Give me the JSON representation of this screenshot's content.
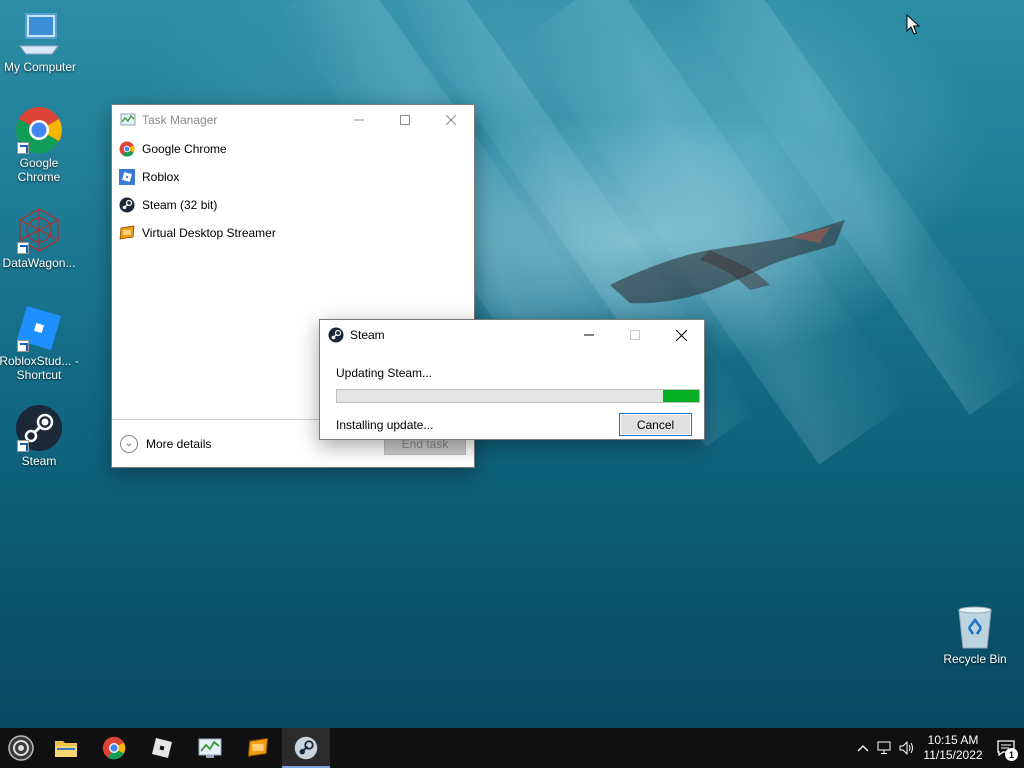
{
  "desktop": {
    "icons": [
      {
        "id": "my-computer",
        "label": "My Computer"
      },
      {
        "id": "google-chrome",
        "label": "Google Chrome"
      },
      {
        "id": "datawagon",
        "label": "DataWagon..."
      },
      {
        "id": "roblox-studio",
        "label": "RobloxStud... - Shortcut"
      },
      {
        "id": "steam",
        "label": "Steam"
      },
      {
        "id": "recycle-bin",
        "label": "Recycle Bin"
      }
    ]
  },
  "task_manager": {
    "title": "Task Manager",
    "processes": [
      {
        "name": "Google Chrome",
        "icon": "chrome-icon"
      },
      {
        "name": "Roblox",
        "icon": "roblox-icon"
      },
      {
        "name": "Steam (32 bit)",
        "icon": "steam-icon"
      },
      {
        "name": "Virtual Desktop Streamer",
        "icon": "vd-streamer-icon"
      }
    ],
    "more_details_label": "More details",
    "end_task_label": "End task"
  },
  "steam_dialog": {
    "title": "Steam",
    "message": "Updating Steam...",
    "progress_fraction": 0.1,
    "status": "Installing update...",
    "cancel_label": "Cancel"
  },
  "taskbar": {
    "clock_time": "10:15 AM",
    "clock_date": "11/15/2022",
    "notification_count": "1"
  },
  "colors": {
    "progress_fill": "#06b025",
    "taskbar_bg": "#101010",
    "focus_border": "#0078d7"
  }
}
